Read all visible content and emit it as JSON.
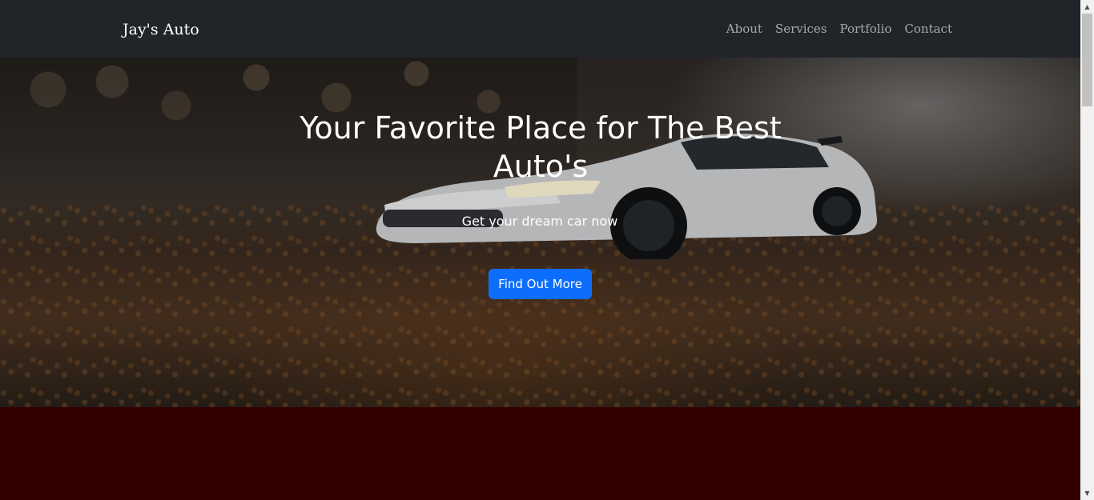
{
  "navbar": {
    "brand": "Jay's Auto",
    "links": [
      "About",
      "Services",
      "Portfolio",
      "Contact"
    ]
  },
  "hero": {
    "title": "Your Favorite Place for The Best Auto's",
    "subtitle": "Get your dream car now",
    "button_label": "Find Out More"
  },
  "colors": {
    "navbar_bg": "#212529",
    "button_bg": "#0d6efd",
    "section_bg": "#330000"
  },
  "icons": {
    "scroll_up": "chevron-up-icon",
    "scroll_down": "chevron-down-icon"
  }
}
